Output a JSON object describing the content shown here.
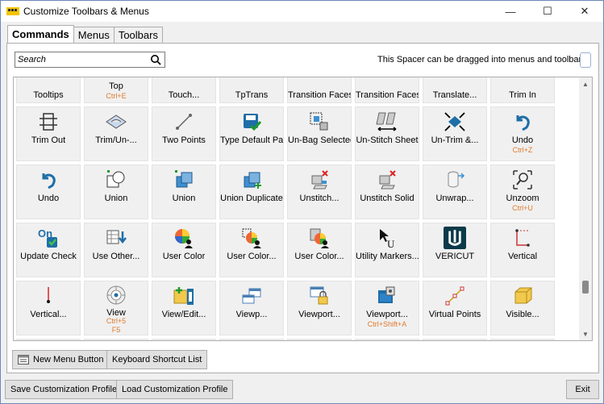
{
  "window": {
    "title": "Customize Toolbars & Menus",
    "minimize": "—",
    "maximize": "☐",
    "close": "✕"
  },
  "tabs": [
    "Commands",
    "Menus",
    "Toolbars"
  ],
  "search": {
    "placeholder": "Search",
    "value": ""
  },
  "spacer_text": "This Spacer can be dragged into menus and toolbars",
  "top_row": [
    {
      "label": "Tooltips",
      "shortcut": ""
    },
    {
      "label": "Top",
      "shortcut": "Ctrl+E"
    },
    {
      "label": "Touch...",
      "shortcut": ""
    },
    {
      "label": "TpTrans",
      "shortcut": ""
    },
    {
      "label": "Transition Faces",
      "shortcut": ""
    },
    {
      "label": "Transition Faces",
      "shortcut": ""
    },
    {
      "label": "Translate...",
      "shortcut": ""
    },
    {
      "label": "Trim In",
      "shortcut": ""
    }
  ],
  "rows": [
    [
      {
        "label": "Trim Out",
        "shortcut": "",
        "icon": "trim-out-icon"
      },
      {
        "label": "Trim/Un-...",
        "shortcut": "",
        "icon": "trim-untrim-icon"
      },
      {
        "label": "Two Points",
        "shortcut": "",
        "icon": "two-points-icon"
      },
      {
        "label": "Type Default Part",
        "shortcut": "",
        "icon": "type-default-part-icon"
      },
      {
        "label": "Un-Bag Selected",
        "shortcut": "",
        "icon": "unbag-icon"
      },
      {
        "label": "Un-Stitch Sheet",
        "shortcut": "",
        "icon": "unstitch-sheet-icon"
      },
      {
        "label": "Un-Trim &...",
        "shortcut": "",
        "icon": "untrim-icon"
      },
      {
        "label": "Undo",
        "shortcut": "Ctrl+Z",
        "icon": "undo-icon"
      }
    ],
    [
      {
        "label": "Undo",
        "shortcut": "",
        "icon": "undo-icon"
      },
      {
        "label": "Union",
        "shortcut": "",
        "icon": "union-outline-icon"
      },
      {
        "label": "Union",
        "shortcut": "",
        "icon": "union-solid-icon"
      },
      {
        "label": "Union Duplicate",
        "shortcut": "",
        "icon": "union-duplicate-icon"
      },
      {
        "label": "Unstitch...",
        "shortcut": "",
        "icon": "unstitch-icon"
      },
      {
        "label": "Unstitch Solid",
        "shortcut": "",
        "icon": "unstitch-solid-icon"
      },
      {
        "label": "Unwrap...",
        "shortcut": "",
        "icon": "unwrap-icon"
      },
      {
        "label": "Unzoom",
        "shortcut": "Ctrl+U",
        "icon": "unzoom-icon"
      }
    ],
    [
      {
        "label": "Update Check",
        "shortcut": "",
        "icon": "update-check-icon"
      },
      {
        "label": "Use Other...",
        "shortcut": "",
        "icon": "use-other-icon"
      },
      {
        "label": "User Color",
        "shortcut": "",
        "icon": "user-color-icon"
      },
      {
        "label": "User Color...",
        "shortcut": "",
        "icon": "user-color-select-icon"
      },
      {
        "label": "User Color...",
        "shortcut": "",
        "icon": "user-color-part-icon"
      },
      {
        "label": "Utility Markers...",
        "shortcut": "",
        "icon": "utility-markers-icon"
      },
      {
        "label": "VERICUT",
        "shortcut": "",
        "icon": "vericut-icon"
      },
      {
        "label": "Vertical",
        "shortcut": "",
        "icon": "vertical-icon"
      }
    ],
    [
      {
        "label": "Vertical...",
        "shortcut": "",
        "icon": "vertical-line-icon"
      },
      {
        "label": "View",
        "shortcut": "Ctrl+5",
        "shortcut2": "F5",
        "icon": "view-icon"
      },
      {
        "label": "View/Edit...",
        "shortcut": "",
        "icon": "view-edit-icon"
      },
      {
        "label": "Viewp...",
        "shortcut": "",
        "icon": "viewport-icon"
      },
      {
        "label": "Viewport...",
        "shortcut": "",
        "icon": "viewport-lock-icon"
      },
      {
        "label": "Viewport...",
        "shortcut": "Ctrl+Shift+A",
        "icon": "viewport-shift-icon"
      },
      {
        "label": "Virtual Points",
        "shortcut": "",
        "icon": "virtual-points-icon"
      },
      {
        "label": "Visible...",
        "shortcut": "",
        "icon": "visible-icon"
      }
    ]
  ],
  "buttons": {
    "new_menu": "New Menu Button",
    "keyboard_shortcuts": "Keyboard Shortcut List",
    "save_profile": "Save Customization Profile",
    "load_profile": "Load Customization Profile",
    "exit": "Exit"
  },
  "colors": {
    "shortcut": "#e07a2c",
    "accent": "#1f6fbf",
    "vericut_bg": "#0b3a4a"
  }
}
